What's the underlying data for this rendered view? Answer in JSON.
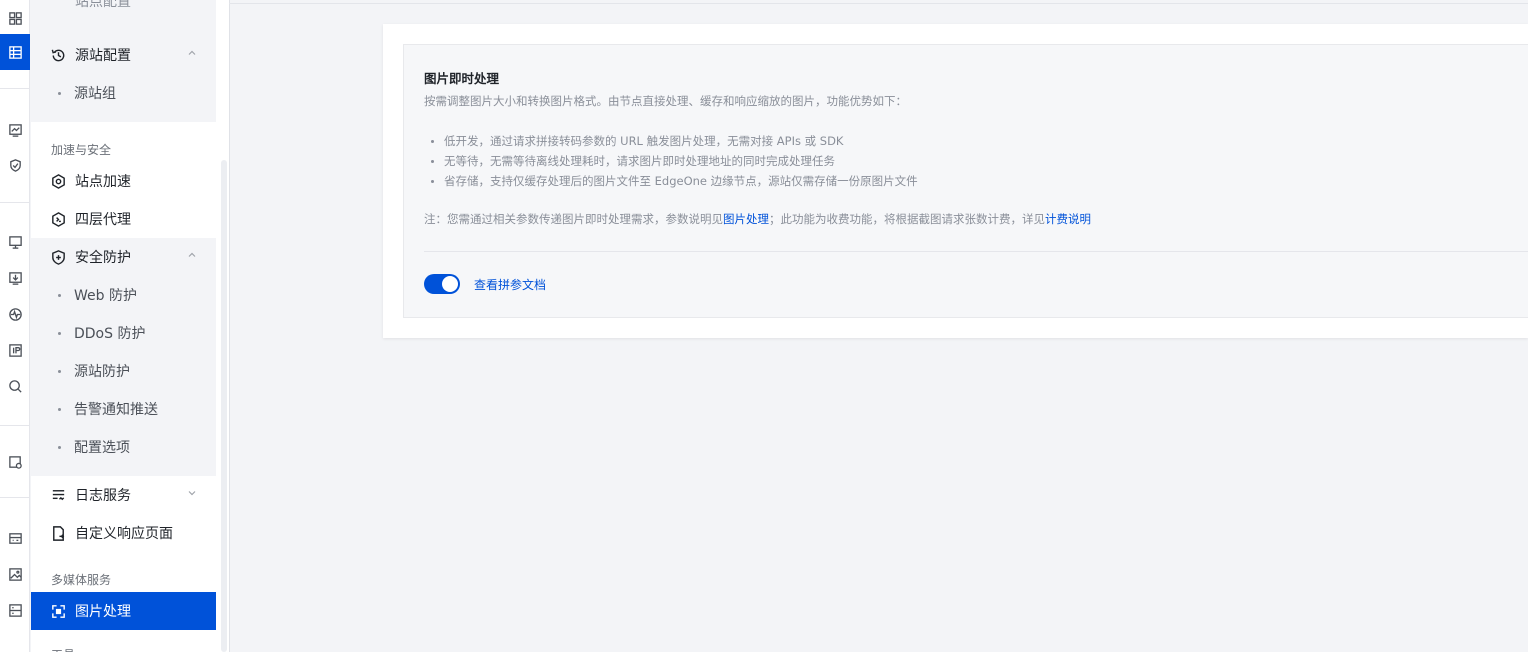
{
  "sidebar": {
    "top_partial": "站点配置",
    "origin_group": {
      "label": "源站配置",
      "children": [
        "源站组"
      ]
    },
    "section_accel": "加速与安全",
    "site_accel": "站点加速",
    "l4_proxy": "四层代理",
    "security": {
      "label": "安全防护",
      "children": [
        "Web 防护",
        "DDoS 防护",
        "源站防护",
        "告警通知推送",
        "配置选项"
      ]
    },
    "log_service": "日志服务",
    "custom_page": "自定义响应页面",
    "section_media": "多媒体服务",
    "image_processing": "图片处理",
    "bottom_partial": "工具"
  },
  "panel": {
    "title": "图片即时处理",
    "description": "按需调整图片大小和转换图片格式。由节点直接处理、缓存和响应缩放的图片，功能优势如下：",
    "features": [
      "低开发，通过请求拼接转码参数的 URL 触发图片处理，无需对接 APIs 或 SDK",
      "无等待，无需等待离线处理耗时，请求图片即时处理地址的同时完成处理任务",
      "省存储，支持仅缓存处理后的图片文件至 EdgeOne 边缘节点，源站仅需存储一份原图片文件"
    ],
    "note_prefix": "注：您需通过相关参数传递图片即时处理需求，参数说明见",
    "note_link1": "图片处理",
    "note_middle": "；此功能为收费功能，将根据截图请求张数计费，详见",
    "note_link2": "计费说明",
    "toggle_on": true,
    "toggle_label": "查看拼参文档"
  },
  "colors": {
    "accent": "#0052d9",
    "panel_bg": "#f6f7f9",
    "group_bg": "#f3f4f7"
  }
}
